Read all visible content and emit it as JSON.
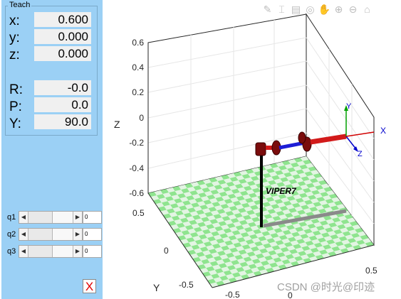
{
  "teach": {
    "title": "Teach",
    "position": [
      {
        "label": "x:",
        "value": "0.600"
      },
      {
        "label": "y:",
        "value": "0.000"
      },
      {
        "label": "z:",
        "value": "0.000"
      }
    ],
    "orientation": [
      {
        "label": "R:",
        "value": "-0.0"
      },
      {
        "label": "P:",
        "value": "0.0"
      },
      {
        "label": "Y:",
        "value": "90.0"
      }
    ],
    "joints": [
      {
        "label": "q1",
        "value": "0"
      },
      {
        "label": "q2",
        "value": "0"
      },
      {
        "label": "q3",
        "value": "0"
      }
    ],
    "close_label": "X"
  },
  "toolbar": {
    "icons": [
      "edit-plot-icon",
      "insert-data-tip-icon",
      "brush-icon",
      "rotate-3d-icon",
      "pan-icon",
      "zoom-in-icon",
      "zoom-out-icon",
      "home-icon"
    ]
  },
  "plot": {
    "z_ticks": [
      "0.6",
      "0.4",
      "0.2",
      "0",
      "-0.2",
      "-0.4",
      "-0.6"
    ],
    "y_ticks": [
      "0.5",
      "0",
      "-0.5"
    ],
    "x_ticks": [
      "0.5",
      "0",
      "-0.5"
    ],
    "z_label": "Z",
    "y_label": "Y",
    "robot_name": "VIPER7",
    "frame_labels": {
      "x": "X",
      "y": "Y",
      "z": "Z"
    },
    "floor_colors": [
      "#8fe48f",
      "#e3f5e3"
    ],
    "colors": {
      "base_link": "#000000",
      "joint": "#7a0c0c",
      "blue_link": "#1d1dd6",
      "red_link": "#d21a1a",
      "shadow": "#8a8a8a",
      "frame_x": "#d00000",
      "frame_y": "#00a000",
      "frame_z": "#0000cc"
    }
  },
  "watermark": "CSDN @时光@印迹"
}
